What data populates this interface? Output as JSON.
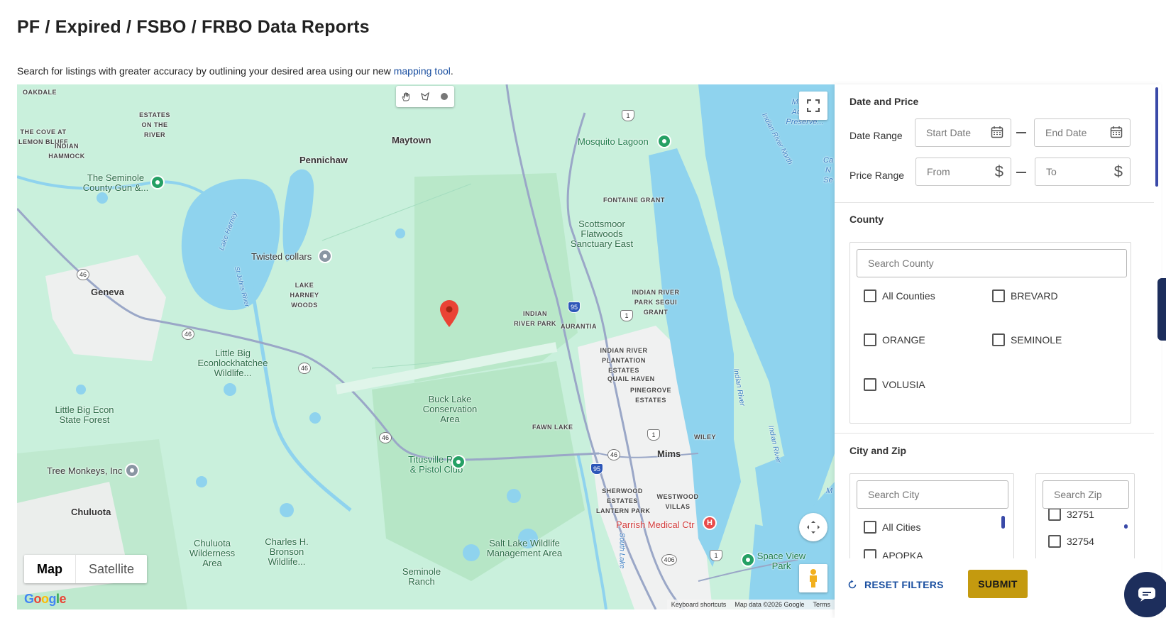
{
  "page": {
    "title": "PF / Expired / FSBO / FRBO Data Reports",
    "intro_text": "Search for listings with greater accuracy by outlining your desired area using our new ",
    "intro_link": "mapping tool",
    "intro_end": "."
  },
  "map": {
    "labels": {
      "oakdale": "OAKDALE",
      "estates_on_the_river": "ESTATES ON THE RIVER",
      "cove_lemon_bluff": "THE COVE AT LEMON BLUFF",
      "indian_hammock": "INDIAN HAMMOCK",
      "maytown": "Maytown",
      "pennichaw": "Pennichaw",
      "seminole_gun": "The Seminole County Gun &...",
      "lake_harney": "Lake Harney",
      "st_johns_river": "St Johns River",
      "twisted_collars": "Twisted collars",
      "lake_harney_woods": "LAKE HARNEY WOODS",
      "geneva": "Geneva",
      "little_big_econ_wildlife": "Little Big Econlockhatchee Wildlife...",
      "little_big_econ_forest": "Little Big Econ State Forest",
      "tree_monkeys": "Tree Monkeys, Inc",
      "chuluota": "Chuluota",
      "chuluota_wilderness": "Chuluota Wilderness Area",
      "charles_bronson": "Charles H. Bronson Wildlife...",
      "seminole_ranch": "Seminole Ranch",
      "salt_lake": "Salt Lake Wildlife Management Area",
      "buck_lake": "Buck Lake Conservation Area",
      "titusville_rifle": "Titusville Rifle & Pistol Club",
      "indian_river_park": "INDIAN RIVER PARK",
      "aurantia": "AURANTIA",
      "mosquito_lagoon": "Mosquito Lagoon",
      "fontaine_grant": "FONTAINE GRANT",
      "scottsmoor": "Scottsmoor Flatwoods Sanctuary East",
      "indian_river_park_segui": "INDIAN RIVER PARK SEGUI GRANT",
      "indian_river_plantation": "INDIAN RIVER PLANTATION ESTATES",
      "quail_haven": "QUAIL HAVEN",
      "pinegrove": "PINEGROVE ESTATES",
      "fawn_lake": "FAWN LAKE",
      "wiley": "WILEY",
      "mims": "Mims",
      "sherwood": "SHERWOOD ESTATES",
      "westwood": "WESTWOOD VILLAS",
      "lantern_park": "LANTERN PARK",
      "parrish": "Parrish Medical Ctr",
      "space_view": "Space View Park",
      "south_lake": "South Lake",
      "indian_river": "Indian River",
      "indian_river_north": "Indian River North",
      "aquatic_preserve": "M... L... Aquatic Preserve...",
      "indian_river_2": "Indian River",
      "ca_n_se": "Ca N Se",
      "m_edge": "M"
    },
    "shields": {
      "r1a": "1",
      "r1b": "1",
      "r1c": "1",
      "r1d": "1",
      "r46a": "46",
      "r46b": "46",
      "r46c": "46",
      "r46d": "46",
      "r46e": "46",
      "i95a": "95",
      "i95b": "95",
      "r406": "406"
    },
    "map_type": {
      "map": "Map",
      "satellite": "Satellite",
      "selected": "map"
    },
    "google_logo": "Google",
    "attribution": {
      "shortcuts": "Keyboard shortcuts",
      "data": "Map data ©2026 Google",
      "terms": "Terms"
    }
  },
  "filters": {
    "date_price": {
      "title": "Date and Price",
      "date_label": "Date Range",
      "start_placeholder": "Start Date",
      "end_placeholder": "End Date",
      "price_label": "Price Range",
      "from_placeholder": "From",
      "to_placeholder": "To"
    },
    "county": {
      "title": "County",
      "search_placeholder": "Search County",
      "options": [
        "All Counties",
        "BREVARD",
        "ORANGE",
        "SEMINOLE",
        "VOLUSIA"
      ]
    },
    "city_zip": {
      "title": "City and Zip",
      "city_placeholder": "Search City",
      "zip_placeholder": "Search Zip",
      "city_options": [
        "All Cities",
        "APOPKA"
      ],
      "zip_options": [
        "32751",
        "32754"
      ]
    },
    "reset_label": "RESET FILTERS",
    "submit_label": "SUBMIT"
  },
  "colors": {
    "link": "#1a4fa0",
    "submit": "#c49a0f",
    "map_land": "#c9f0dc",
    "water": "#8fd3ee",
    "chat": "#1d2e5c"
  }
}
